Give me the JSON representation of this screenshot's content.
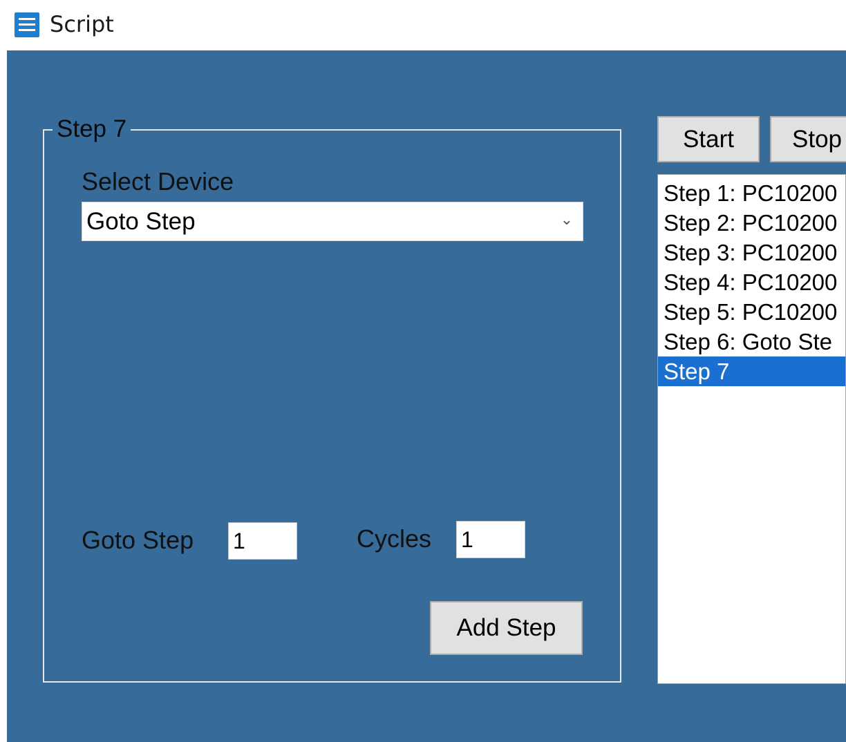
{
  "window": {
    "title": "Script",
    "icon": "menu-icon"
  },
  "step_panel": {
    "legend": "Step 7",
    "select_device_label": "Select Device",
    "device_value": "Goto Step",
    "goto_step_label": "Goto Step",
    "goto_step_value": "1",
    "cycles_label": "Cycles",
    "cycles_value": "1",
    "add_step_button": "Add Step"
  },
  "controls": {
    "start_button": "Start",
    "stop_button": "Stop"
  },
  "step_list": {
    "items": [
      "Step 1: PC10200",
      "Step 2: PC10200",
      "Step 3: PC10200",
      "Step 4: PC10200",
      "Step 5: PC10200",
      "Step 6: Goto Ste",
      "Step 7"
    ],
    "selected_index": 6
  },
  "colors": {
    "background": "#376b99",
    "selection": "#1b6fd0",
    "icon": "#1e7fd0"
  }
}
